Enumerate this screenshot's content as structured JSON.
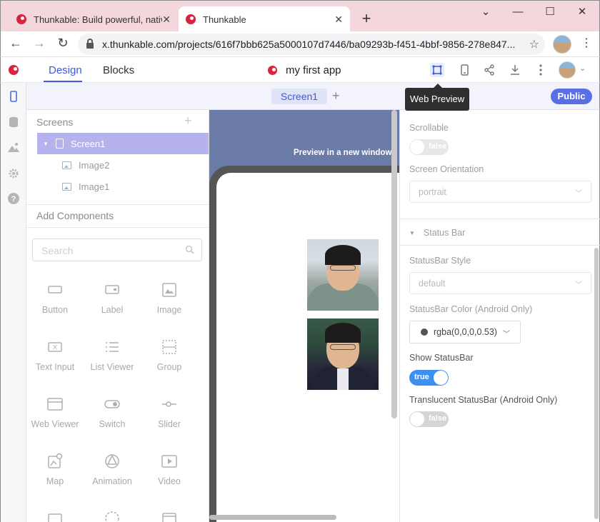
{
  "browser": {
    "tabs": [
      {
        "title": "Thunkable: Build powerful, native"
      },
      {
        "title": "Thunkable"
      }
    ],
    "url": "x.thunkable.com/projects/616f7bbb625a5000107d7446/ba09293b-f451-4bbf-9856-278e847..."
  },
  "header": {
    "tab_design": "Design",
    "tab_blocks": "Blocks",
    "project_name": "my first app"
  },
  "tooltip": "Web Preview",
  "screen_tabs": {
    "active": "Screen1",
    "public_label": "Public"
  },
  "screens": {
    "title": "Screens",
    "items": [
      {
        "label": "Screen1"
      },
      {
        "label": "Image2"
      },
      {
        "label": "Image1"
      }
    ]
  },
  "components": {
    "title": "Add Components",
    "search_placeholder": "Search",
    "items": [
      {
        "label": "Button",
        "icon": "button-icon"
      },
      {
        "label": "Label",
        "icon": "label-icon"
      },
      {
        "label": "Image",
        "icon": "image-icon"
      },
      {
        "label": "Text Input",
        "icon": "text-input-icon"
      },
      {
        "label": "List Viewer",
        "icon": "list-viewer-icon"
      },
      {
        "label": "Group",
        "icon": "group-icon"
      },
      {
        "label": "Web Viewer",
        "icon": "web-viewer-icon"
      },
      {
        "label": "Switch",
        "icon": "switch-icon"
      },
      {
        "label": "Slider",
        "icon": "slider-icon"
      },
      {
        "label": "Map",
        "icon": "map-icon"
      },
      {
        "label": "Animation",
        "icon": "animation-icon"
      },
      {
        "label": "Video",
        "icon": "video-icon"
      }
    ]
  },
  "canvas": {
    "preview_label": "Preview in a new window"
  },
  "properties": {
    "scrollable_label": "Scrollable",
    "scrollable_value": "false",
    "orientation_label": "Screen Orientation",
    "orientation_value": "portrait",
    "status_bar_section": "Status Bar",
    "statusbar_style_label": "StatusBar Style",
    "statusbar_style_value": "default",
    "statusbar_color_label": "StatusBar Color (Android Only)",
    "statusbar_color_value": "rgba(0,0,0,0.53)",
    "show_statusbar_label": "Show StatusBar",
    "show_statusbar_value": "true",
    "translucent_label": "Translucent StatusBar (Android Only)",
    "translucent_value": "false"
  },
  "colors": {
    "accent": "#3b5bdb",
    "public_button": "#5a6ee6",
    "selected_screen": "#b6b2ee",
    "toggle_on": "#3d8ff0",
    "brand": "#d9233f"
  }
}
